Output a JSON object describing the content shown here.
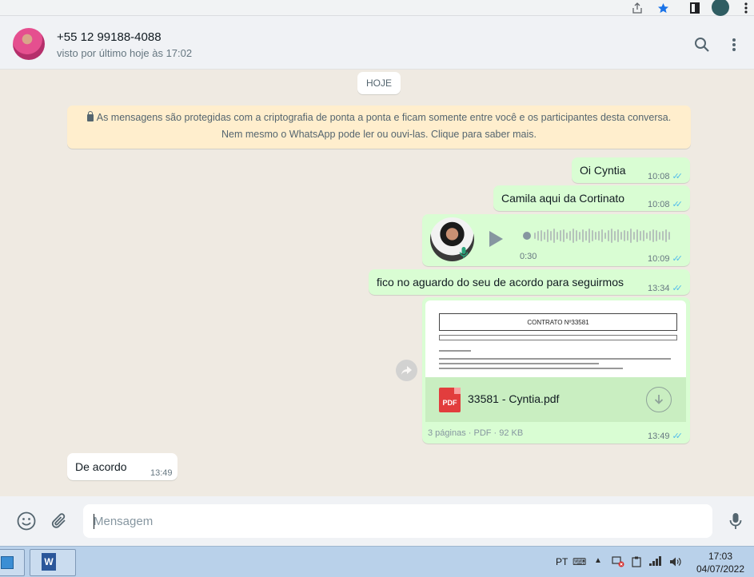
{
  "browser": {
    "icons": [
      "share-icon",
      "bookmark-star-icon",
      "sidepanel-icon",
      "profile-icon",
      "menu-icon"
    ]
  },
  "header": {
    "contact_name": "+55 12 99188-4088",
    "last_seen": "visto por último hoje às 17:02",
    "icons": [
      "search-icon",
      "more-menu-icon"
    ]
  },
  "chat": {
    "date_chip": "HOJE",
    "encryption_notice": "As mensagens são protegidas com a criptografia de ponta a ponta e ficam somente entre você e os participantes desta conversa. Nem mesmo o WhatsApp pode ler ou ouvi-las. Clique para saber mais.",
    "messages": [
      {
        "direction": "out",
        "text": "Oi Cyntia",
        "time": "10:08",
        "status": "read"
      },
      {
        "direction": "out",
        "text": "Camila aqui da Cortinato",
        "time": "10:08",
        "status": "read"
      },
      {
        "direction": "out",
        "type": "voice",
        "duration": "0:30",
        "time": "10:09",
        "status": "read"
      },
      {
        "direction": "out",
        "text": "fico no aguardo do seu de acordo para seguirmos",
        "time": "13:34",
        "status": "read"
      },
      {
        "direction": "out",
        "type": "document",
        "preview_title": "CONTRATO Nº33581",
        "icon_label": "PDF",
        "file_name": "33581 - Cyntia.pdf",
        "info": "3 páginas · PDF · 92 KB",
        "time": "13:49",
        "status": "read"
      },
      {
        "direction": "in",
        "text": "De acordo",
        "time": "13:49"
      }
    ]
  },
  "composer": {
    "placeholder": "Mensagem",
    "icons": [
      "emoji-icon",
      "attach-icon",
      "mic-icon"
    ]
  },
  "taskbar": {
    "language": "PT",
    "time": "17:03",
    "date": "04/07/2022",
    "word_icon_label": "W"
  },
  "colors": {
    "outgoing_bubble": "#d9fdd3",
    "incoming_bubble": "#ffffff",
    "chat_background": "#efeae2",
    "read_ticks": "#53bdeb",
    "notice_background": "#ffeecd"
  }
}
